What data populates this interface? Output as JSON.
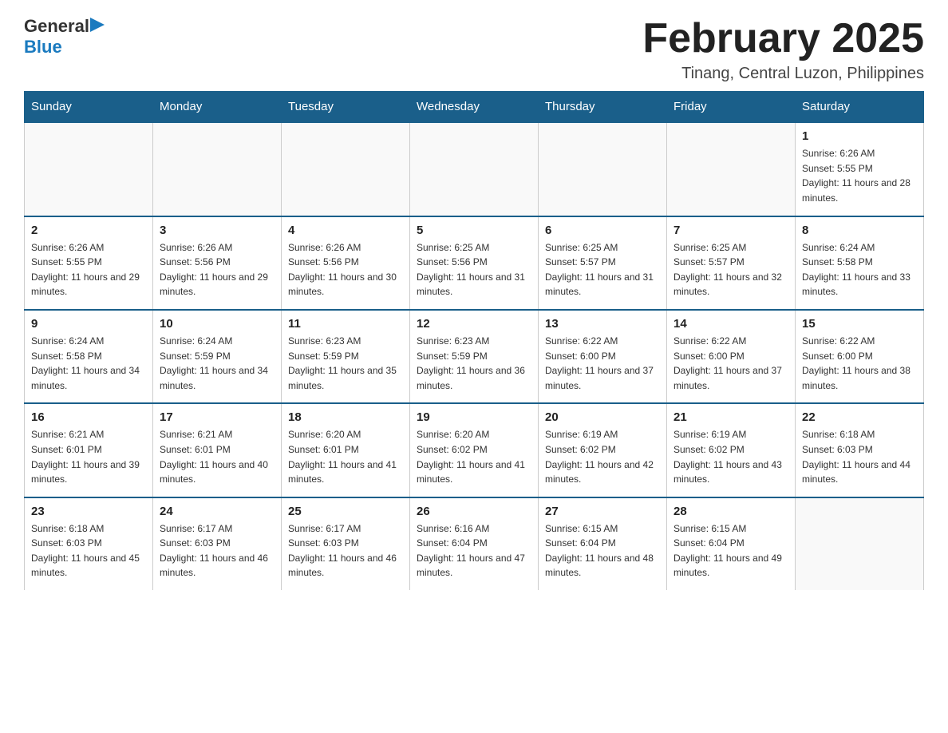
{
  "header": {
    "logo_general": "General",
    "logo_blue": "Blue",
    "month_title": "February 2025",
    "location": "Tinang, Central Luzon, Philippines"
  },
  "days_of_week": [
    "Sunday",
    "Monday",
    "Tuesday",
    "Wednesday",
    "Thursday",
    "Friday",
    "Saturday"
  ],
  "weeks": [
    [
      {
        "day": "",
        "info": ""
      },
      {
        "day": "",
        "info": ""
      },
      {
        "day": "",
        "info": ""
      },
      {
        "day": "",
        "info": ""
      },
      {
        "day": "",
        "info": ""
      },
      {
        "day": "",
        "info": ""
      },
      {
        "day": "1",
        "info": "Sunrise: 6:26 AM\nSunset: 5:55 PM\nDaylight: 11 hours and 28 minutes."
      }
    ],
    [
      {
        "day": "2",
        "info": "Sunrise: 6:26 AM\nSunset: 5:55 PM\nDaylight: 11 hours and 29 minutes."
      },
      {
        "day": "3",
        "info": "Sunrise: 6:26 AM\nSunset: 5:56 PM\nDaylight: 11 hours and 29 minutes."
      },
      {
        "day": "4",
        "info": "Sunrise: 6:26 AM\nSunset: 5:56 PM\nDaylight: 11 hours and 30 minutes."
      },
      {
        "day": "5",
        "info": "Sunrise: 6:25 AM\nSunset: 5:56 PM\nDaylight: 11 hours and 31 minutes."
      },
      {
        "day": "6",
        "info": "Sunrise: 6:25 AM\nSunset: 5:57 PM\nDaylight: 11 hours and 31 minutes."
      },
      {
        "day": "7",
        "info": "Sunrise: 6:25 AM\nSunset: 5:57 PM\nDaylight: 11 hours and 32 minutes."
      },
      {
        "day": "8",
        "info": "Sunrise: 6:24 AM\nSunset: 5:58 PM\nDaylight: 11 hours and 33 minutes."
      }
    ],
    [
      {
        "day": "9",
        "info": "Sunrise: 6:24 AM\nSunset: 5:58 PM\nDaylight: 11 hours and 34 minutes."
      },
      {
        "day": "10",
        "info": "Sunrise: 6:24 AM\nSunset: 5:59 PM\nDaylight: 11 hours and 34 minutes."
      },
      {
        "day": "11",
        "info": "Sunrise: 6:23 AM\nSunset: 5:59 PM\nDaylight: 11 hours and 35 minutes."
      },
      {
        "day": "12",
        "info": "Sunrise: 6:23 AM\nSunset: 5:59 PM\nDaylight: 11 hours and 36 minutes."
      },
      {
        "day": "13",
        "info": "Sunrise: 6:22 AM\nSunset: 6:00 PM\nDaylight: 11 hours and 37 minutes."
      },
      {
        "day": "14",
        "info": "Sunrise: 6:22 AM\nSunset: 6:00 PM\nDaylight: 11 hours and 37 minutes."
      },
      {
        "day": "15",
        "info": "Sunrise: 6:22 AM\nSunset: 6:00 PM\nDaylight: 11 hours and 38 minutes."
      }
    ],
    [
      {
        "day": "16",
        "info": "Sunrise: 6:21 AM\nSunset: 6:01 PM\nDaylight: 11 hours and 39 minutes."
      },
      {
        "day": "17",
        "info": "Sunrise: 6:21 AM\nSunset: 6:01 PM\nDaylight: 11 hours and 40 minutes."
      },
      {
        "day": "18",
        "info": "Sunrise: 6:20 AM\nSunset: 6:01 PM\nDaylight: 11 hours and 41 minutes."
      },
      {
        "day": "19",
        "info": "Sunrise: 6:20 AM\nSunset: 6:02 PM\nDaylight: 11 hours and 41 minutes."
      },
      {
        "day": "20",
        "info": "Sunrise: 6:19 AM\nSunset: 6:02 PM\nDaylight: 11 hours and 42 minutes."
      },
      {
        "day": "21",
        "info": "Sunrise: 6:19 AM\nSunset: 6:02 PM\nDaylight: 11 hours and 43 minutes."
      },
      {
        "day": "22",
        "info": "Sunrise: 6:18 AM\nSunset: 6:03 PM\nDaylight: 11 hours and 44 minutes."
      }
    ],
    [
      {
        "day": "23",
        "info": "Sunrise: 6:18 AM\nSunset: 6:03 PM\nDaylight: 11 hours and 45 minutes."
      },
      {
        "day": "24",
        "info": "Sunrise: 6:17 AM\nSunset: 6:03 PM\nDaylight: 11 hours and 46 minutes."
      },
      {
        "day": "25",
        "info": "Sunrise: 6:17 AM\nSunset: 6:03 PM\nDaylight: 11 hours and 46 minutes."
      },
      {
        "day": "26",
        "info": "Sunrise: 6:16 AM\nSunset: 6:04 PM\nDaylight: 11 hours and 47 minutes."
      },
      {
        "day": "27",
        "info": "Sunrise: 6:15 AM\nSunset: 6:04 PM\nDaylight: 11 hours and 48 minutes."
      },
      {
        "day": "28",
        "info": "Sunrise: 6:15 AM\nSunset: 6:04 PM\nDaylight: 11 hours and 49 minutes."
      },
      {
        "day": "",
        "info": ""
      }
    ]
  ]
}
